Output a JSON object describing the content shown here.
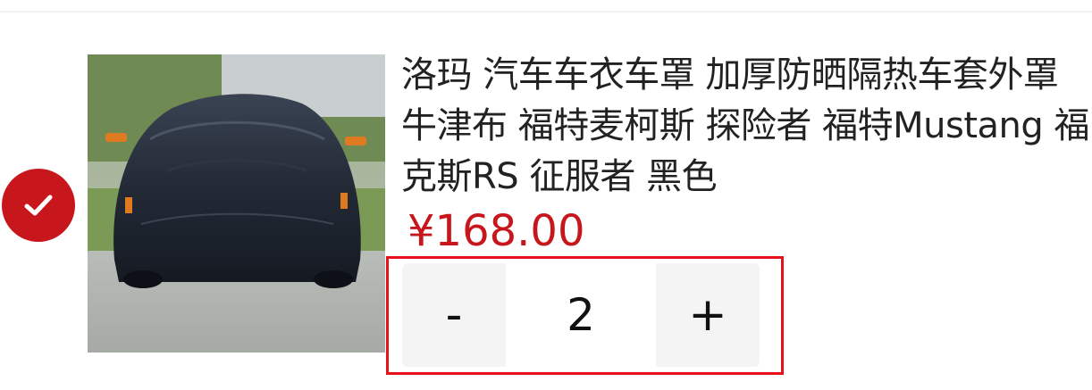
{
  "cart_item": {
    "selected": true,
    "image_alt": "car-cover-photo",
    "title": "洛玛 汽车车衣车罩 加厚防晒隔热车套外罩牛津布 福特麦柯斯 探险者 福特Mustang 福克斯RS 征服者 黑色",
    "price": "¥168.00",
    "quantity": {
      "decrement_label": "-",
      "value": "2",
      "increment_label": "+"
    }
  },
  "colors": {
    "accent": "#c8161d",
    "highlight_border": "#e8111a"
  }
}
